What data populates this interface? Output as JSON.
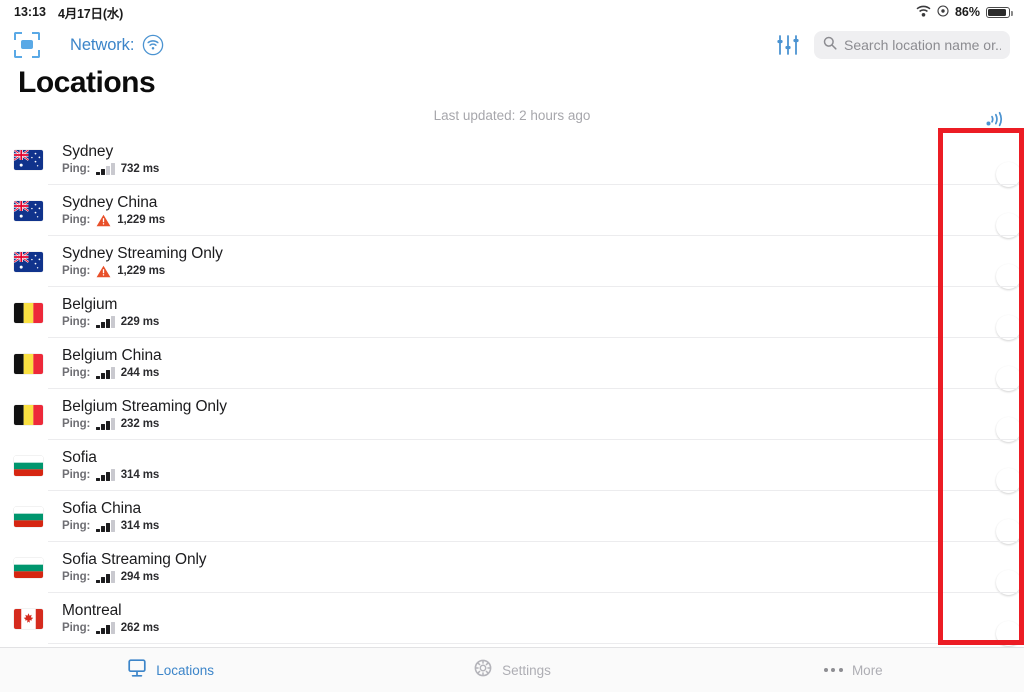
{
  "statusbar": {
    "time": "13:13",
    "date": "4月17日(水)",
    "wifi_icon": "wifi-icon",
    "location_icon": "location-services-icon",
    "battery_percent": "86%",
    "battery_icon": "battery-icon"
  },
  "header": {
    "scan_icon": "scan-frame-icon",
    "network_label": "Network:",
    "network_status_icon": "wifi-circle-icon",
    "filter_icon": "filter-sliders-icon",
    "search": {
      "icon": "search-icon",
      "value": "",
      "placeholder": "Search location name or..."
    }
  },
  "page_title": "Locations",
  "list_header": {
    "last_updated": "Last updated: 2 hours ago",
    "ping_all_icon": "ping-waves-icon"
  },
  "colors": {
    "accent_blue": "#3c85c9",
    "warning_orange": "#e8502a",
    "annotation_red": "#ec1c24",
    "toggle_off": "#e6e6ea",
    "separator": "#ececee",
    "muted_text": "#a7a7ac"
  },
  "locations": [
    {
      "name": "Sydney",
      "flag": "australia-flag",
      "ping_label": "Ping:",
      "bars": 2,
      "ping": "732 ms",
      "warning": false,
      "toggle": "off"
    },
    {
      "name": "Sydney China",
      "flag": "australia-flag",
      "ping_label": "Ping:",
      "bars": 0,
      "ping": "1,229 ms",
      "warning": true,
      "toggle": "off"
    },
    {
      "name": "Sydney Streaming Only",
      "flag": "australia-flag",
      "ping_label": "Ping:",
      "bars": 0,
      "ping": "1,229 ms",
      "warning": true,
      "toggle": "off"
    },
    {
      "name": "Belgium",
      "flag": "belgium-flag",
      "ping_label": "Ping:",
      "bars": 3,
      "ping": "229 ms",
      "warning": false,
      "toggle": "off"
    },
    {
      "name": "Belgium China",
      "flag": "belgium-flag",
      "ping_label": "Ping:",
      "bars": 3,
      "ping": "244 ms",
      "warning": false,
      "toggle": "off"
    },
    {
      "name": "Belgium Streaming Only",
      "flag": "belgium-flag",
      "ping_label": "Ping:",
      "bars": 3,
      "ping": "232 ms",
      "warning": false,
      "toggle": "off"
    },
    {
      "name": "Sofia",
      "flag": "bulgaria-flag",
      "ping_label": "Ping:",
      "bars": 3,
      "ping": "314 ms",
      "warning": false,
      "toggle": "off"
    },
    {
      "name": "Sofia China",
      "flag": "bulgaria-flag",
      "ping_label": "Ping:",
      "bars": 3,
      "ping": "314 ms",
      "warning": false,
      "toggle": "off"
    },
    {
      "name": "Sofia Streaming Only",
      "flag": "bulgaria-flag",
      "ping_label": "Ping:",
      "bars": 3,
      "ping": "294 ms",
      "warning": false,
      "toggle": "off"
    },
    {
      "name": "Montreal",
      "flag": "canada-flag",
      "ping_label": "Ping:",
      "bars": 3,
      "ping": "262 ms",
      "warning": false,
      "toggle": "off"
    }
  ],
  "tabbar": [
    {
      "label": "Locations",
      "icon": "monitor-icon",
      "active": true
    },
    {
      "label": "Settings",
      "icon": "gear-icon",
      "active": false
    },
    {
      "label": "More",
      "icon": "ellipsis-icon",
      "active": false
    }
  ]
}
